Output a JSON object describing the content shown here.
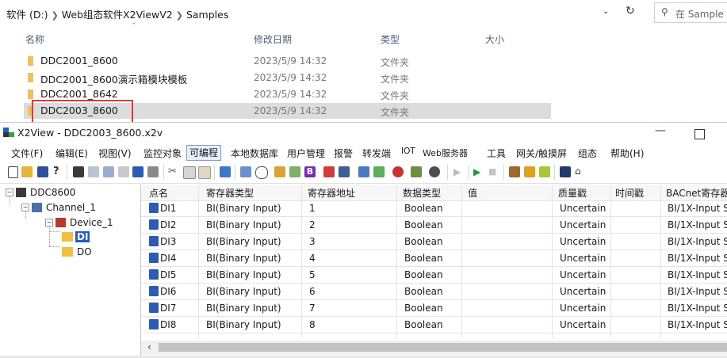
{
  "explorer": {
    "breadcrumbs": [
      "软件 (D:)",
      "Web组态软件X2ViewV2",
      "Samples"
    ],
    "search_placeholder": "在 Sample",
    "columns": {
      "name": "名称",
      "date": "修改日期",
      "type": "类型",
      "size": "大小"
    },
    "folders": [
      {
        "name": "DDC2001_8600",
        "date": "2023/5/9 14:32",
        "type": "文件夹"
      },
      {
        "name": "DDC2001_8600演示箱模块模板",
        "date": "2023/5/9 14:32",
        "type": "文件夹"
      },
      {
        "name": "DDC2001_8642",
        "date": "2023/5/9 14:32",
        "type": "文件夹"
      },
      {
        "name": "DDC2003_8600",
        "date": "2023/5/9 14:32",
        "type": "文件夹"
      }
    ]
  },
  "app": {
    "title": "X2View - DDC2003_8600.x2v",
    "menu": [
      "文件(F)",
      "编辑(E)",
      "视图(V)",
      "监控对象",
      "可编程",
      "本地数据库",
      "用户管理",
      "报警",
      "转发端",
      "IOT",
      "Web服务器",
      "工具",
      "网关/触摸屏",
      "组态",
      "帮助(H)"
    ],
    "tree": {
      "root": "DDC8600",
      "channel": "Channel_1",
      "device": "Device_1",
      "di": "DI",
      "do": "DO"
    },
    "grid": {
      "headers": [
        "点名",
        "寄存器类型",
        "寄存器地址",
        "数据类型",
        "值",
        "质量戳",
        "时间戳",
        "BACnet寄存器"
      ],
      "rows": [
        {
          "name": "DI1",
          "reg_type": "BI(Binary Input)",
          "addr": "1",
          "dtype": "Boolean",
          "value": "",
          "quality": "Uncertain",
          "time": "",
          "bacnet": "BI/1X-Input S"
        },
        {
          "name": "DI2",
          "reg_type": "BI(Binary Input)",
          "addr": "2",
          "dtype": "Boolean",
          "value": "",
          "quality": "Uncertain",
          "time": "",
          "bacnet": "BI/1X-Input S"
        },
        {
          "name": "DI3",
          "reg_type": "BI(Binary Input)",
          "addr": "3",
          "dtype": "Boolean",
          "value": "",
          "quality": "Uncertain",
          "time": "",
          "bacnet": "BI/1X-Input S"
        },
        {
          "name": "DI4",
          "reg_type": "BI(Binary Input)",
          "addr": "4",
          "dtype": "Boolean",
          "value": "",
          "quality": "Uncertain",
          "time": "",
          "bacnet": "BI/1X-Input S"
        },
        {
          "name": "DI5",
          "reg_type": "BI(Binary Input)",
          "addr": "5",
          "dtype": "Boolean",
          "value": "",
          "quality": "Uncertain",
          "time": "",
          "bacnet": "BI/1X-Input S"
        },
        {
          "name": "DI6",
          "reg_type": "BI(Binary Input)",
          "addr": "6",
          "dtype": "Boolean",
          "value": "",
          "quality": "Uncertain",
          "time": "",
          "bacnet": "BI/1X-Input S"
        },
        {
          "name": "DI7",
          "reg_type": "BI(Binary Input)",
          "addr": "7",
          "dtype": "Boolean",
          "value": "",
          "quality": "Uncertain",
          "time": "",
          "bacnet": "BI/1X-Input S"
        },
        {
          "name": "DI8",
          "reg_type": "BI(Binary Input)",
          "addr": "8",
          "dtype": "Boolean",
          "value": "",
          "quality": "Uncertain",
          "time": "",
          "bacnet": "BI/1X-Input S"
        }
      ]
    },
    "colors": {
      "highlight_box": "#e53935",
      "tree_selected": "#1f5fbf",
      "folder": "#f2c14e"
    }
  }
}
